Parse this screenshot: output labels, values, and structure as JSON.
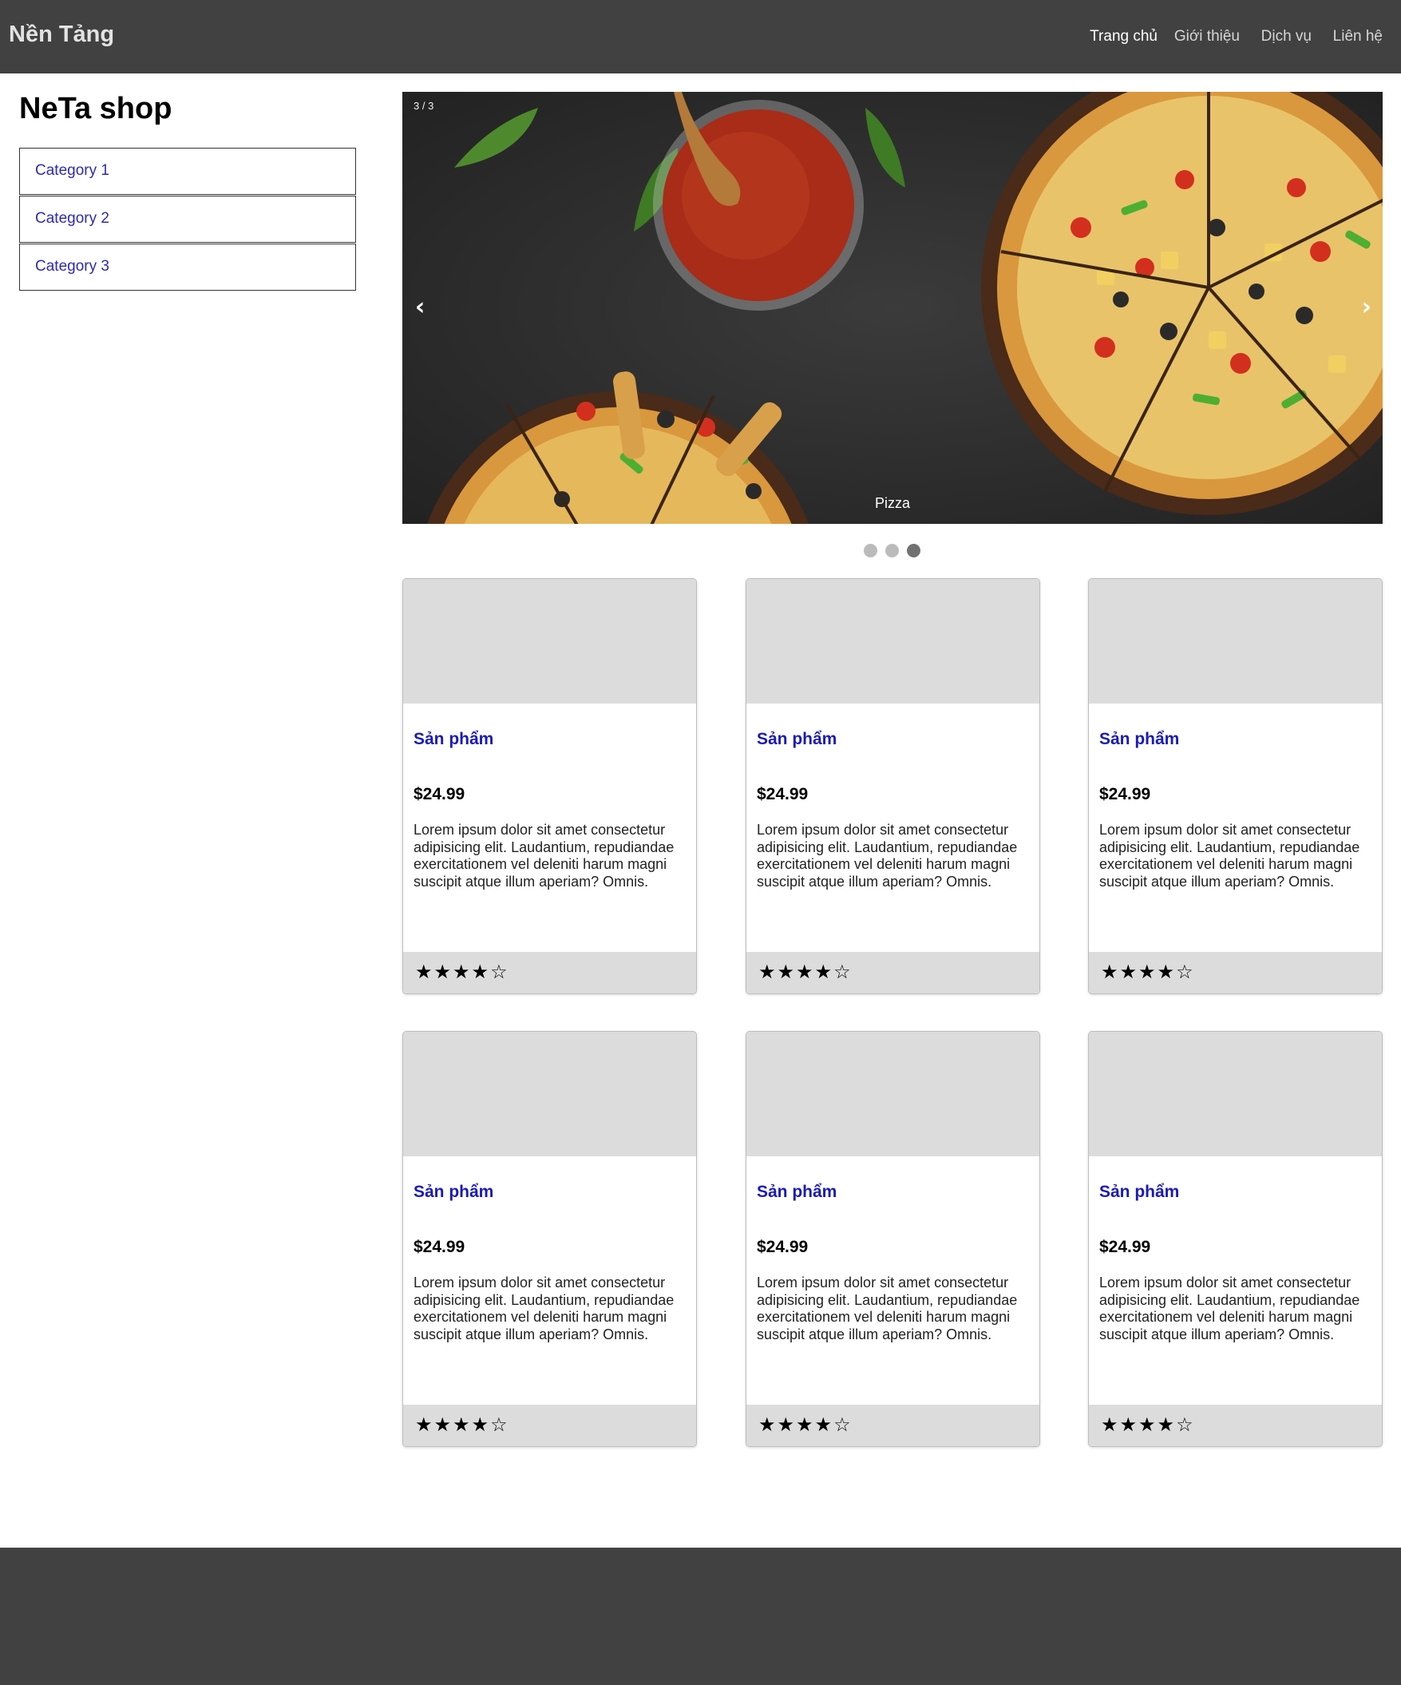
{
  "navbar": {
    "brand": "Nền Tảng",
    "links": [
      "Trang chủ",
      "Giới thiệu",
      "Dịch vụ",
      "Liên hệ"
    ],
    "active_index": 0
  },
  "sidebar": {
    "title": "NeTa shop",
    "categories": [
      "Category 1",
      "Category 2",
      "Category 3"
    ]
  },
  "carousel": {
    "counter": "3 / 3",
    "caption": "Pizza",
    "prev_icon": "‹",
    "next_icon": "›",
    "dot_count": 3,
    "active_dot": 2
  },
  "products": [
    {
      "name": "Sản phẩm",
      "price": "$24.99",
      "description": "Lorem ipsum dolor sit amet consectetur adipisicing elit. Laudantium, repudiandae exercitationem vel deleniti harum magni suscipit atque illum aperiam? Omnis.",
      "rating": 4,
      "max_rating": 5
    },
    {
      "name": "Sản phẩm",
      "price": "$24.99",
      "description": "Lorem ipsum dolor sit amet consectetur adipisicing elit. Laudantium, repudiandae exercitationem vel deleniti harum magni suscipit atque illum aperiam? Omnis.",
      "rating": 4,
      "max_rating": 5
    },
    {
      "name": "Sản phẩm",
      "price": "$24.99",
      "description": "Lorem ipsum dolor sit amet consectetur adipisicing elit. Laudantium, repudiandae exercitationem vel deleniti harum magni suscipit atque illum aperiam? Omnis.",
      "rating": 4,
      "max_rating": 5
    },
    {
      "name": "Sản phẩm",
      "price": "$24.99",
      "description": "Lorem ipsum dolor sit amet consectetur adipisicing elit. Laudantium, repudiandae exercitationem vel deleniti harum magni suscipit atque illum aperiam? Omnis.",
      "rating": 4,
      "max_rating": 5
    },
    {
      "name": "Sản phẩm",
      "price": "$24.99",
      "description": "Lorem ipsum dolor sit amet consectetur adipisicing elit. Laudantium, repudiandae exercitationem vel deleniti harum magni suscipit atque illum aperiam? Omnis.",
      "rating": 4,
      "max_rating": 5
    },
    {
      "name": "Sản phẩm",
      "price": "$24.99",
      "description": "Lorem ipsum dolor sit amet consectetur adipisicing elit. Laudantium, repudiandae exercitationem vel deleniti harum magni suscipit atque illum aperiam? Omnis.",
      "rating": 4,
      "max_rating": 5
    }
  ],
  "colors": {
    "navbar_bg": "#414141",
    "footer_bg": "#414141",
    "link_blue": "#1a1ab8",
    "card_gray": "#dcdcdc"
  }
}
